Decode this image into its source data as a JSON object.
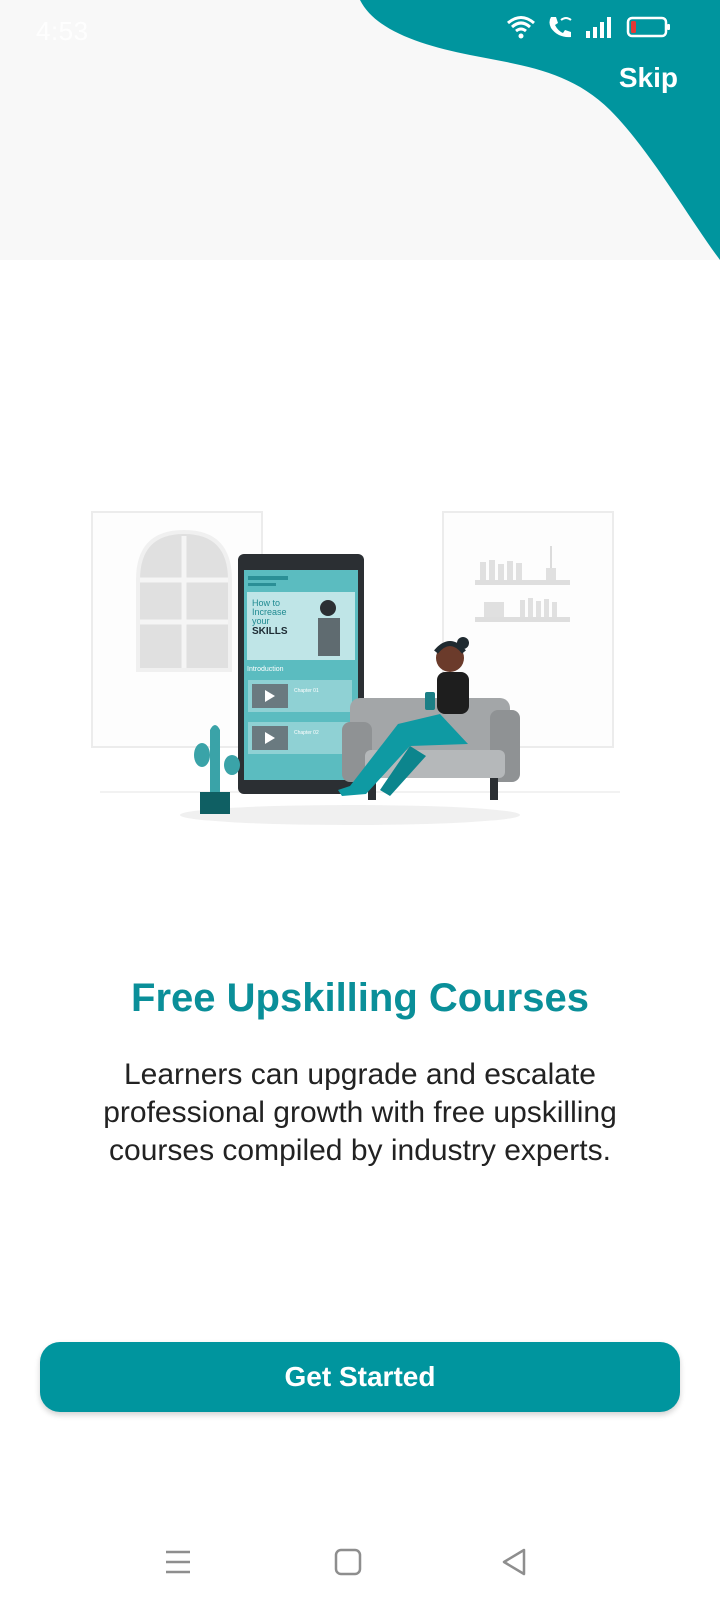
{
  "colors": {
    "accent": "#00959e",
    "title": "#0a8f99",
    "top_band": "#f8f8f8",
    "battery_low": "#e53935"
  },
  "status_bar": {
    "time": "4:53",
    "icons": [
      "wifi-icon",
      "wifi-call-icon",
      "signal-icon",
      "battery-icon"
    ]
  },
  "header": {
    "skip_label": "Skip"
  },
  "illustration": {
    "phone_screen": {
      "heading_line1": "How to",
      "heading_line2": "Increase",
      "heading_line3": "your",
      "heading_line4": "SKILLS",
      "section_label": "Introduction",
      "chapter1": "Chapter 01",
      "chapter2": "Chapter 02"
    }
  },
  "content": {
    "title": "Free Upskilling Courses",
    "description": "Learners can upgrade and escalate professional growth with free upskilling courses compiled by industry experts."
  },
  "cta": {
    "label": "Get Started"
  },
  "nav": {
    "icons": [
      "menu-icon",
      "home-icon",
      "back-icon"
    ]
  }
}
